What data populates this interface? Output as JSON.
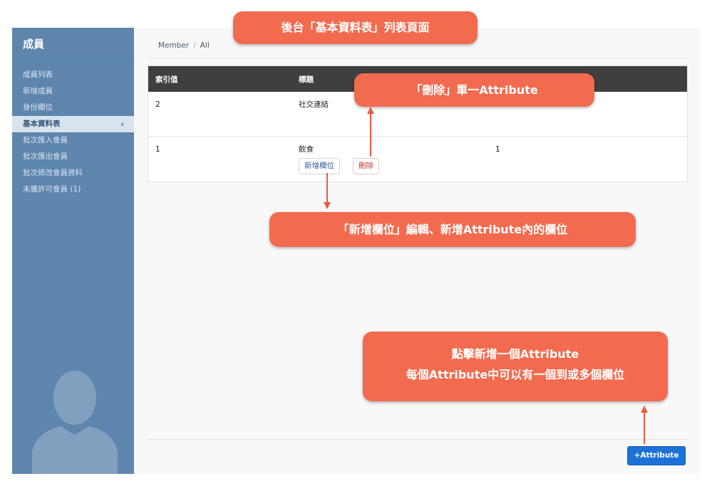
{
  "sidebar": {
    "title": "成員",
    "items": [
      {
        "label": "成員列表"
      },
      {
        "label": "新增成員"
      },
      {
        "label": "身份欄位"
      },
      {
        "label": "基本資料表",
        "chevron": "›"
      },
      {
        "label": "批次匯入會員"
      },
      {
        "label": "批次匯出會員"
      },
      {
        "label": "批次修改會員資料"
      },
      {
        "label": "未獲許可會員 (1)"
      }
    ]
  },
  "breadcrumb": {
    "root": "Member",
    "separator": "/",
    "current": "All"
  },
  "table": {
    "headers": [
      "索引值",
      "標題"
    ],
    "rows": [
      {
        "index": "2",
        "title": "社交連結",
        "extra": ""
      },
      {
        "index": "1",
        "title": "飲食",
        "extra": "1"
      }
    ],
    "add_field_label": "新增欄位",
    "delete_label": "刪除"
  },
  "add_attribute_label": "+Attribute",
  "annotations": {
    "page_title": "後台「基本資料表」列表頁面",
    "delete_note": "「刪除」單一Attribute",
    "add_field_note": "「新增欄位」編輯、新增Attribute內的欄位",
    "add_attr_note_line1": "點擊新增一個Attribute",
    "add_attr_note_line2": "每個Attribute中可以有一個到或多個欄位"
  },
  "colors": {
    "sidebar_bg": "#5e86ad",
    "table_header_bg": "#3f3f3f",
    "primary_button": "#1d72d8",
    "callout": "#f26b4f"
  },
  "icons": {
    "menu_chevron": "chevron-right-icon",
    "avatar": "user-silhouette-icon"
  }
}
